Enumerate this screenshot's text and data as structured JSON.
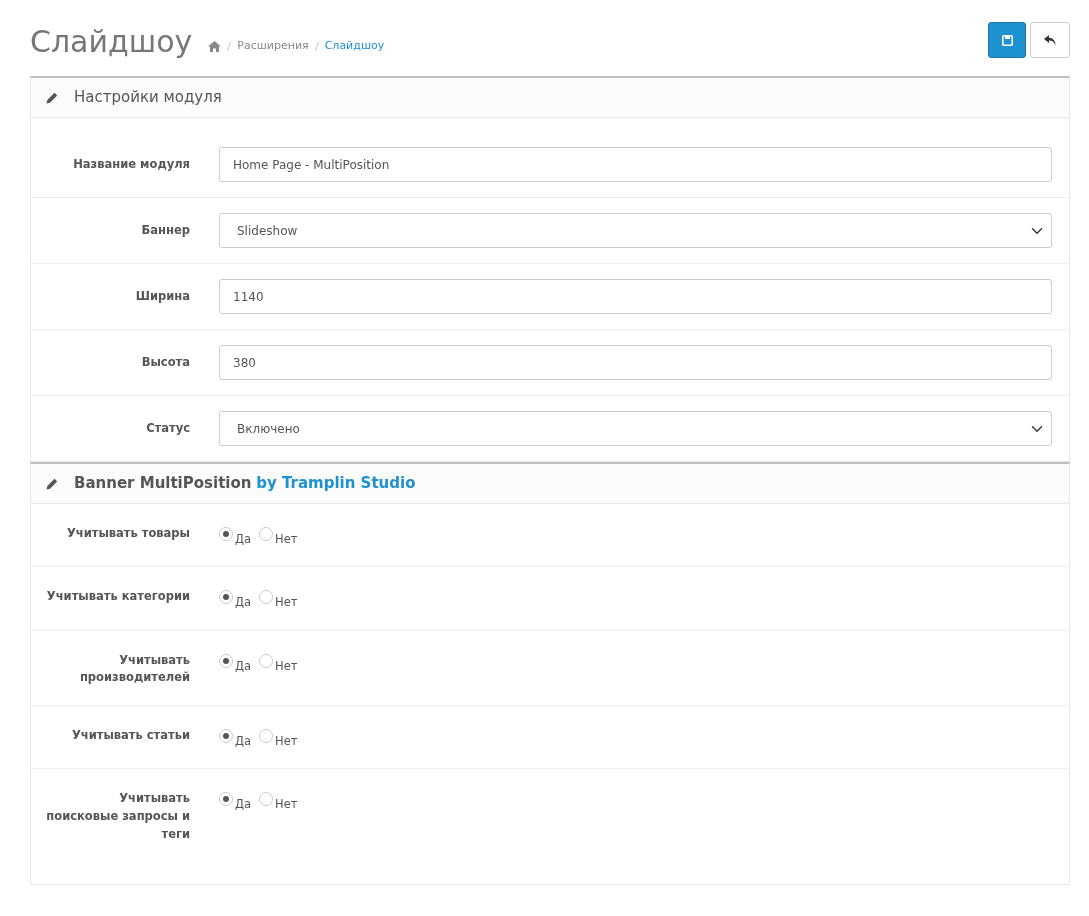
{
  "header": {
    "title": "Слайдшоу",
    "breadcrumbs": [
      {
        "label": "Расширения",
        "selected": false
      },
      {
        "label": "Слайдшоу",
        "selected": true
      }
    ]
  },
  "module_panel": {
    "title": "Настройки модуля",
    "fields": [
      {
        "label": "Название модуля",
        "kind": "text",
        "value": "Home Page - MultiPosition"
      },
      {
        "label": "Баннер",
        "kind": "select",
        "value": "Slideshow"
      },
      {
        "label": "Ширина",
        "kind": "text",
        "value": "1140"
      },
      {
        "label": "Высота",
        "kind": "text",
        "value": "380"
      },
      {
        "label": "Статус",
        "kind": "select",
        "value": "Включено"
      }
    ]
  },
  "banner_panel": {
    "title": "Banner MultiPosition",
    "title_link": "by Tramplin Studio",
    "options": [
      {
        "label": "Учитывать товары",
        "choices": [
          {
            "label": "Да",
            "selected": true
          },
          {
            "label": "Нет",
            "selected": false
          }
        ]
      },
      {
        "label": "Учитывать категории",
        "choices": [
          {
            "label": "Да",
            "selected": true
          },
          {
            "label": "Нет",
            "selected": false
          }
        ]
      },
      {
        "label": "Учитывать производителей",
        "choices": [
          {
            "label": "Да",
            "selected": true
          },
          {
            "label": "Нет",
            "selected": false
          }
        ]
      },
      {
        "label": "Учитывать статьи",
        "choices": [
          {
            "label": "Да",
            "selected": true
          },
          {
            "label": "Нет",
            "selected": false
          }
        ]
      },
      {
        "label": "Учитывать поисковые запросы и теги",
        "choices": [
          {
            "label": "Да",
            "selected": true
          },
          {
            "label": "Нет",
            "selected": false
          }
        ]
      }
    ]
  }
}
